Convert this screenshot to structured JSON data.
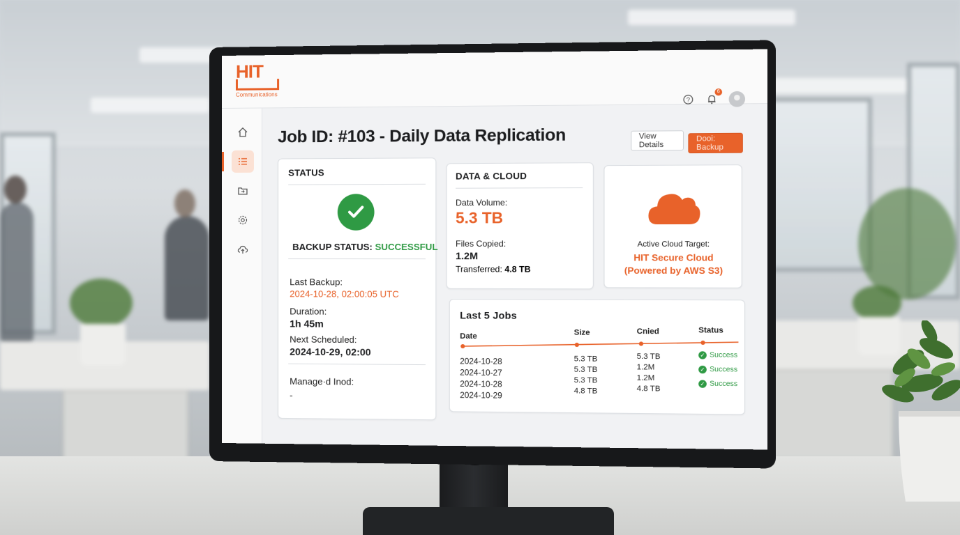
{
  "app": {
    "logo_text": "HIT",
    "logo_sub": "Communications",
    "notification_count": "6"
  },
  "sidebar": {
    "items": [
      {
        "icon": "home-icon"
      },
      {
        "icon": "jobs-list-icon",
        "active": true
      },
      {
        "icon": "folder-icon"
      },
      {
        "icon": "gear-icon"
      },
      {
        "icon": "cloud-upload-icon"
      }
    ]
  },
  "header": {
    "title": "Job ID: #103 - Daily Data Replication",
    "view_details_label": "View Details",
    "run_backup_label": "Dooi: Backup"
  },
  "status_card": {
    "heading": "STATUS",
    "backup_status_label": "BACKUP STATUS:",
    "backup_status_value": "SUCCESSFUL",
    "last_backup_label": "Last Backup:",
    "last_backup_value": "2024-10-28, 02:00:05 UTC",
    "duration_label": "Duration:",
    "duration_value": "1h 45m",
    "next_scheduled_label": "Next Scheduled:",
    "next_scheduled_value": "2024-10-29, 02:00",
    "managed_label": "Manage·d Inod:",
    "managed_value": "-"
  },
  "data_card": {
    "heading": "DATA & CLOUD",
    "volume_label": "Data Volume:",
    "volume_value": "5.3 TB",
    "files_label": "Files Copied:",
    "files_value": "1.2M",
    "transferred_label": "Transferred:",
    "transferred_value": "4.8 TB"
  },
  "cloud_card": {
    "label": "Active Cloud Target:",
    "target_name": "HIT Secure Cloud",
    "target_sub": "(Powered by AWS S3)"
  },
  "jobs_card": {
    "heading": "Last 5 Jobs",
    "columns": {
      "date": "Date",
      "size": "Size",
      "copied": "Cnied",
      "status": "Status"
    },
    "dates": [
      "2024-10-28",
      "2024-10-27",
      "2024-10-28",
      "2024-10-29"
    ],
    "sizes": [
      "5.3 TB",
      "5.3 TB",
      "5.3 TB",
      "4.8 TB"
    ],
    "copied": [
      "5.3 TB",
      "1.2M",
      "1.2M",
      "4.8 TB"
    ],
    "statuses": [
      "Success",
      "Success",
      "Success"
    ]
  },
  "colors": {
    "accent": "#e8622a",
    "success": "#2f9a44"
  }
}
